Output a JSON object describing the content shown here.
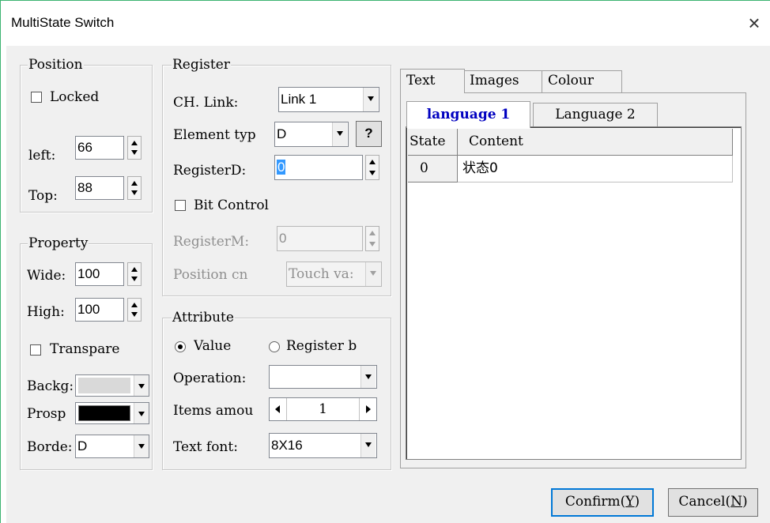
{
  "window": {
    "title": "MultiState Switch",
    "close_glyph": "×"
  },
  "position": {
    "legend": "Position",
    "locked_label": "Locked",
    "locked_checked": false,
    "left_label": "left:",
    "left_value": "66",
    "top_label": "Top:",
    "top_value": "88"
  },
  "property": {
    "legend": "Property",
    "wide_label": "Wide:",
    "wide_value": "100",
    "high_label": "High:",
    "high_value": "100",
    "transparent_label": "Transpare",
    "transparent_checked": false,
    "background_label": "Backg:",
    "background_color": "#d9d9d9",
    "prospect_label": "Prosp",
    "prospect_color": "#000000",
    "border_label": "Borde:",
    "border_value": "D"
  },
  "register": {
    "legend": "Register",
    "ch_link_label": "CH. Link:",
    "ch_link_value": "Link 1",
    "element_type_label": "Element typ",
    "element_type_value": "D",
    "help_button": "?",
    "register_d_label": "RegisterD:",
    "register_d_value": "0",
    "bit_control_label": "Bit Control",
    "bit_control_checked": false,
    "register_m_label": "RegisterM:",
    "register_m_value": "0",
    "position_cn_label": "Position cn",
    "position_cn_value": "Touch va:"
  },
  "attribute": {
    "legend": "Attribute",
    "value_label": "Value",
    "value_selected": true,
    "register_b_label": "Register b",
    "register_b_selected": false,
    "operation_label": "Operation:",
    "operation_value": "",
    "items_label": "Items amou",
    "items_value": "1",
    "text_font_label": "Text font:",
    "text_font_value": "8X16"
  },
  "tabs": {
    "outer": [
      "Text",
      "Images",
      "Colour"
    ],
    "outer_selected": 0,
    "inner": [
      "language 1",
      "Language 2"
    ],
    "inner_selected": 0
  },
  "grid": {
    "headers": [
      "State",
      "Content"
    ],
    "rows": [
      [
        "0",
        "状态0"
      ]
    ]
  },
  "buttons": {
    "confirm_text": "Confirm(",
    "confirm_key": "Y",
    "confirm_close": ")",
    "cancel_text": "Cancel(",
    "cancel_key": "N",
    "cancel_close": ")"
  },
  "colors": {
    "accent": "#0078d7",
    "tab_selected_text": "#0000c0",
    "frame_edge": "#3cb371"
  }
}
